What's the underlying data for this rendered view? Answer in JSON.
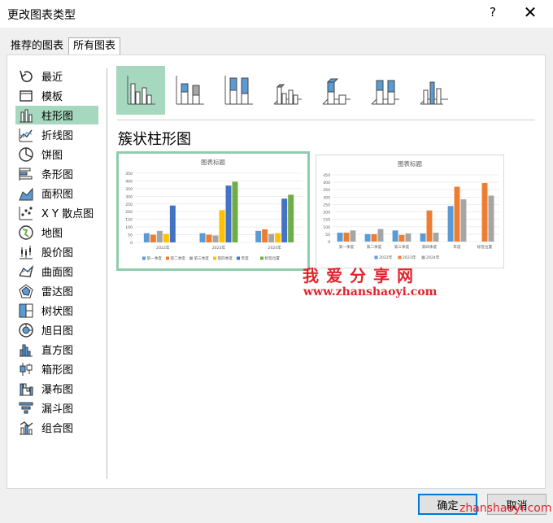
{
  "window": {
    "title": "更改图表类型",
    "help": "?",
    "close": "✕"
  },
  "tabs": [
    {
      "label": "推荐的图表"
    },
    {
      "label": "所有图表"
    }
  ],
  "sidebar": {
    "items": [
      {
        "label": "最近",
        "icon": "recent-icon"
      },
      {
        "label": "模板",
        "icon": "template-icon"
      },
      {
        "label": "柱形图",
        "icon": "column-chart-icon",
        "selected": true
      },
      {
        "label": "折线图",
        "icon": "line-chart-icon"
      },
      {
        "label": "饼图",
        "icon": "pie-chart-icon"
      },
      {
        "label": "条形图",
        "icon": "bar-chart-icon"
      },
      {
        "label": "面积图",
        "icon": "area-chart-icon"
      },
      {
        "label": "X Y 散点图",
        "icon": "scatter-chart-icon"
      },
      {
        "label": "地图",
        "icon": "map-chart-icon"
      },
      {
        "label": "股价图",
        "icon": "stock-chart-icon"
      },
      {
        "label": "曲面图",
        "icon": "surface-chart-icon"
      },
      {
        "label": "雷达图",
        "icon": "radar-chart-icon"
      },
      {
        "label": "树状图",
        "icon": "treemap-chart-icon"
      },
      {
        "label": "旭日图",
        "icon": "sunburst-chart-icon"
      },
      {
        "label": "直方图",
        "icon": "histogram-chart-icon"
      },
      {
        "label": "箱形图",
        "icon": "box-whisker-chart-icon"
      },
      {
        "label": "瀑布图",
        "icon": "waterfall-chart-icon"
      },
      {
        "label": "漏斗图",
        "icon": "funnel-chart-icon"
      },
      {
        "label": "组合图",
        "icon": "combo-chart-icon"
      }
    ]
  },
  "subtype": {
    "title": "簇状柱形图"
  },
  "colors": {
    "blue": "#5b9bd5",
    "orange": "#ed7d31",
    "gray": "#a5a5a5",
    "yellow": "#ffc000",
    "darkblue": "#4472c4",
    "green": "#70ad47",
    "accent": "#a6d8bf"
  },
  "chart_data": [
    {
      "type": "bar",
      "title": "图表标题",
      "categories": [
        "2022年",
        "2023年",
        "2024年"
      ],
      "ylim": [
        0,
        450
      ],
      "yticks": [
        "0",
        "50",
        "100",
        "150",
        "200",
        "250",
        "300",
        "350",
        "400",
        "450"
      ],
      "series": [
        {
          "name": "第一季度",
          "values": [
            60,
            60,
            75
          ]
        },
        {
          "name": "第二季度",
          "values": [
            50,
            50,
            85
          ]
        },
        {
          "name": "第三季度",
          "values": [
            75,
            45,
            55
          ]
        },
        {
          "name": "第四季度",
          "values": [
            55,
            210,
            60
          ]
        },
        {
          "name": "年度",
          "values": [
            240,
            370,
            285
          ]
        },
        {
          "name": "标签位置",
          "values": [
            0,
            395,
            310
          ]
        }
      ]
    },
    {
      "type": "bar",
      "title": "图表标题",
      "categories": [
        "第一季度",
        "第二季度",
        "第三季度",
        "第四季度",
        "年度",
        "标签位置"
      ],
      "ylim": [
        0,
        450
      ],
      "yticks": [
        "0",
        "50",
        "100",
        "150",
        "200",
        "250",
        "300",
        "350",
        "400",
        "450"
      ],
      "series": [
        {
          "name": "2022年",
          "values": [
            60,
            50,
            75,
            55,
            240,
            0
          ]
        },
        {
          "name": "2023年",
          "values": [
            60,
            50,
            45,
            210,
            370,
            395
          ]
        },
        {
          "name": "2024年",
          "values": [
            75,
            85,
            55,
            60,
            285,
            310
          ]
        }
      ]
    }
  ],
  "watermark": {
    "line1": "我爱分享网",
    "line2": "www.zhanshaoyi.com",
    "corner": "zhanshaoyi.com"
  },
  "buttons": {
    "ok": "确定",
    "cancel": "取消"
  }
}
